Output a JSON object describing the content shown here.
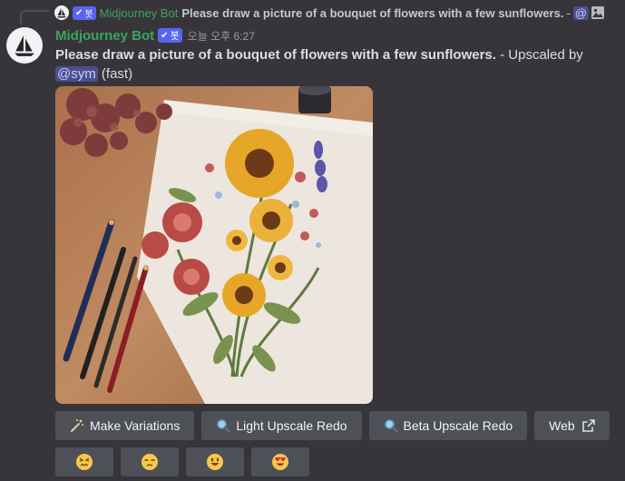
{
  "reply": {
    "username": "Midjourney Bot",
    "badge": "봇",
    "text": "Please draw a picture of a bouquet of flowers with a few sunflowers.",
    "dash": "-",
    "mention_symbol": "@"
  },
  "message": {
    "username": "Midjourney Bot",
    "badge": "봇",
    "timestamp": "오늘 오후 6:27",
    "prompt": "Please draw a picture of a bouquet of flowers with a few sunflowers.",
    "suffix": " - Upscaled by ",
    "mention": "@sym",
    "speed": " (fast)"
  },
  "buttons": [
    {
      "label": "Make Variations",
      "icon": "magic-wand-icon"
    },
    {
      "label": "Light Upscale Redo",
      "icon": "magnifier-icon"
    },
    {
      "label": "Beta Upscale Redo",
      "icon": "magnifier-icon"
    },
    {
      "label": "Web",
      "icon": "external-link-icon"
    }
  ],
  "reactions": [
    {
      "icon": "confounded-face-icon"
    },
    {
      "icon": "unamused-face-icon"
    },
    {
      "icon": "smiley-face-icon"
    },
    {
      "icon": "heart-eyes-face-icon"
    }
  ],
  "colors": {
    "background": "#37353a",
    "username": "#3ba55c",
    "badge": "#5865f2",
    "button": "#4e5058",
    "mention_bg": "#4a4f8f"
  }
}
